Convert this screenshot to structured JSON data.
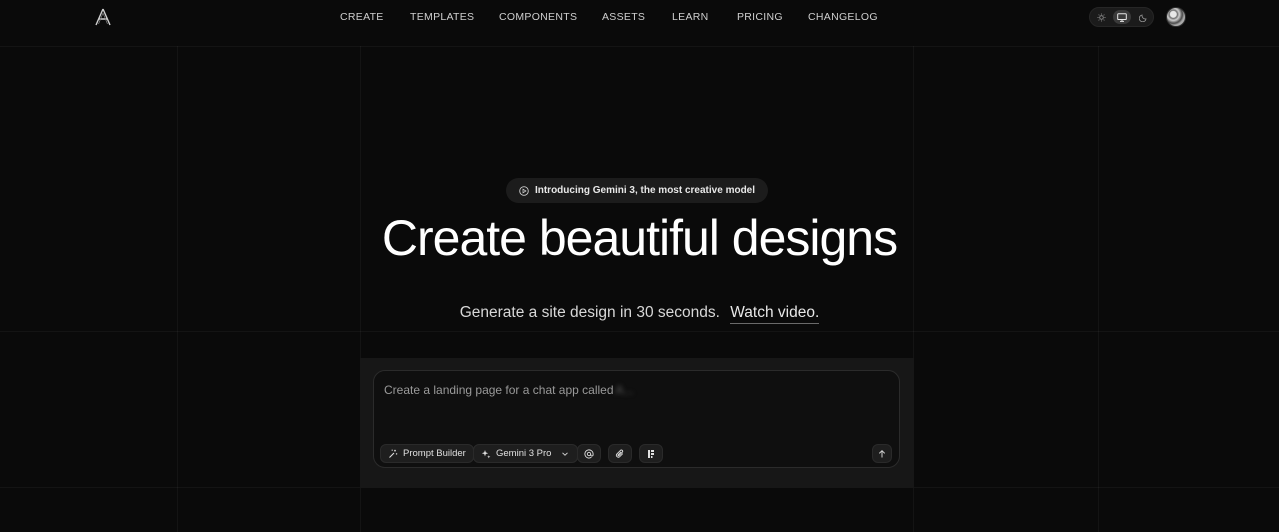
{
  "nav": {
    "items": [
      {
        "label": "CREATE"
      },
      {
        "label": "TEMPLATES"
      },
      {
        "label": "COMPONENTS"
      },
      {
        "label": "ASSETS"
      },
      {
        "label": "LEARN"
      },
      {
        "label": "PRICING"
      },
      {
        "label": "CHANGELOG"
      }
    ]
  },
  "theme": {
    "options": [
      "sun-icon",
      "monitor-icon",
      "moon-icon"
    ],
    "selected": "monitor-icon"
  },
  "hero": {
    "announcement": "Introducing Gemini 3, the most creative model",
    "title": "Create beautiful designs",
    "subtitle": "Generate a site design in 30 seconds.",
    "watch_link": "Watch video."
  },
  "prompt": {
    "placeholder": "Create a landing page for a chat app called",
    "blurred_suffix": "A..."
  },
  "toolbar": {
    "prompt_builder_label": "Prompt Builder",
    "model_label": "Gemini 3 Pro",
    "icons": [
      "wand-icon",
      "sparkle-icon",
      "chevron-down-icon",
      "at-icon",
      "paperclip-icon",
      "layout-icon",
      "arrow-up-icon"
    ]
  },
  "colors": {
    "background": "#0a0a0a",
    "panel": "#171717",
    "text": "#ffffff",
    "muted": "#9a9a9a"
  }
}
